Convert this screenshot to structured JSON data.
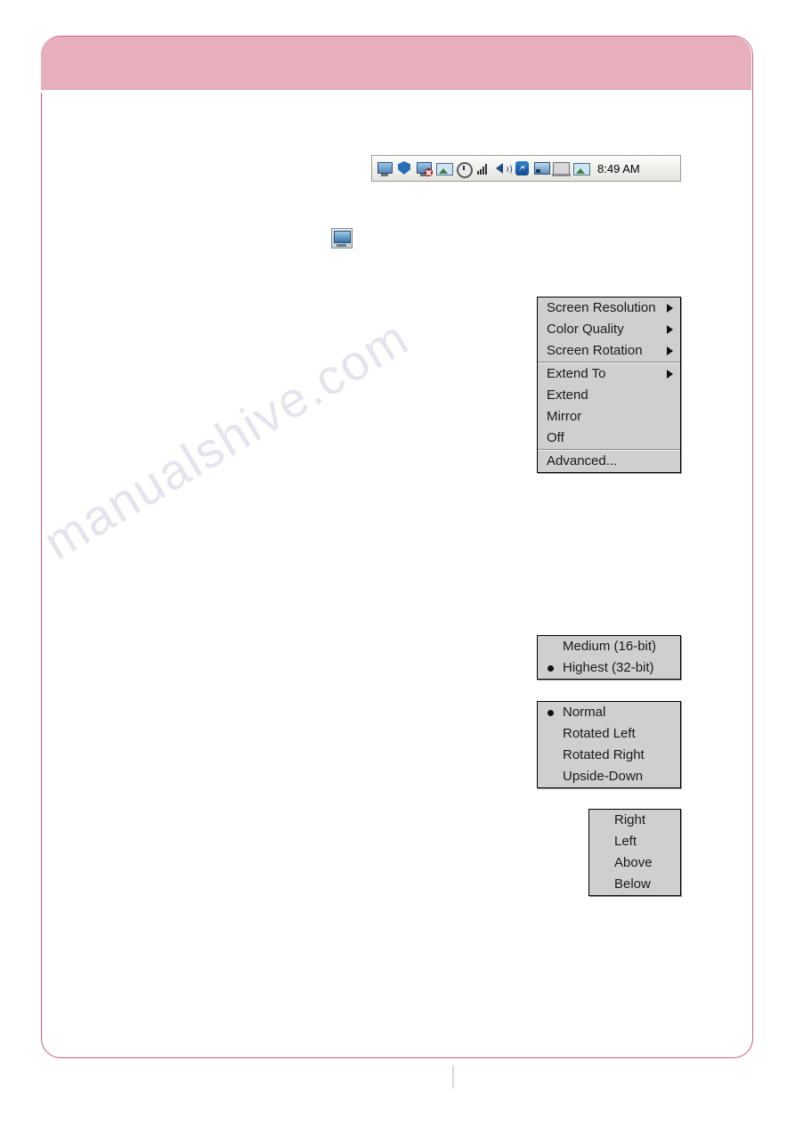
{
  "tray": {
    "time": "8:49 AM",
    "icons": [
      "network-monitor-icon",
      "shield-icon",
      "network-disconnected-icon",
      "display-switch-icon",
      "clock-icon",
      "signal-bars-icon",
      "volume-icon",
      "bluetooth-icon",
      "network-status-icon",
      "laptop-display-icon",
      "picture-icon"
    ]
  },
  "desktop_icon": {
    "name": "display-tray-icon"
  },
  "menus": {
    "main": {
      "name": "display-context-menu",
      "items": [
        {
          "label": "Screen Resolution",
          "submenu": true,
          "separator_after": false
        },
        {
          "label": "Color Quality",
          "submenu": true,
          "separator_after": false
        },
        {
          "label": "Screen Rotation",
          "submenu": true,
          "separator_after": true
        },
        {
          "label": "Extend To",
          "submenu": true,
          "separator_after": false
        },
        {
          "label": "Extend",
          "submenu": false,
          "separator_after": false
        },
        {
          "label": "Mirror",
          "submenu": false,
          "separator_after": false
        },
        {
          "label": "Off",
          "submenu": false,
          "separator_after": true
        },
        {
          "label": "Advanced...",
          "submenu": false,
          "separator_after": false
        }
      ]
    },
    "color_quality": {
      "name": "color-quality-submenu",
      "items": [
        {
          "label": "Medium (16-bit)",
          "selected": false
        },
        {
          "label": "Highest (32-bit)",
          "selected": true
        }
      ]
    },
    "screen_rotation": {
      "name": "screen-rotation-submenu",
      "items": [
        {
          "label": "Normal",
          "selected": true
        },
        {
          "label": "Rotated Left",
          "selected": false
        },
        {
          "label": "Rotated Right",
          "selected": false
        },
        {
          "label": "Upside-Down",
          "selected": false
        }
      ]
    },
    "extend_to": {
      "name": "extend-to-submenu",
      "items": [
        {
          "label": "Right",
          "selected": false
        },
        {
          "label": "Left",
          "selected": false
        },
        {
          "label": "Above",
          "selected": false
        },
        {
          "label": "Below",
          "selected": false
        }
      ]
    }
  },
  "watermark": {
    "text": "manualshive.com"
  },
  "colors": {
    "header_band": "#e7afbe",
    "page_border": "#c8607f",
    "menu_bg": "#cfcfcf"
  }
}
